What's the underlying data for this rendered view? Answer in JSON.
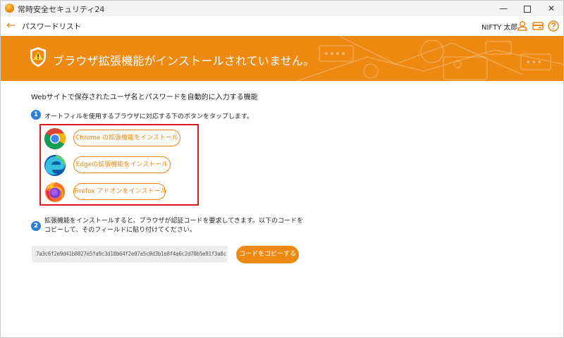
{
  "window": {
    "app_title": "常時安全セキュリティ24",
    "minimize_glyph": "—",
    "close_glyph": "✕"
  },
  "nav": {
    "title": "パスワードリスト",
    "user_name": "NIFTY 太郎",
    "back_glyph": "←"
  },
  "banner": {
    "message": "ブラウザ拡張機能がインストールされていません。"
  },
  "content": {
    "intro": "Webサイトで保存されたユーザ名とパスワードを自動的に入力する機能",
    "step1": {
      "number": "1",
      "text": "オートフィルを使用するブラウザに対応する下のボタンをタップします。"
    },
    "buttons": {
      "chrome": "Chrome の拡張機能をインストール",
      "edge": "Edgeの拡張機能をインストール",
      "firefox": "Firefox アドオンをインストール"
    },
    "step2": {
      "number": "2",
      "text": "拡張機能をインストールすると、ブラウザが認証コードを要求してきます。以下のコードをコピーして、そのフィールドに貼り付けてください。"
    },
    "code_value": "7a3c6f2e9d41b8027e5fa9c3d18b64f2e07a5c9d3b1e8f4a6c2d70b5e91f3a8c",
    "copy_button": "コードをコピーする"
  },
  "colors": {
    "accent": "#ee8a12",
    "step_badge": "#2d7fd6",
    "highlight": "#e0141e"
  }
}
